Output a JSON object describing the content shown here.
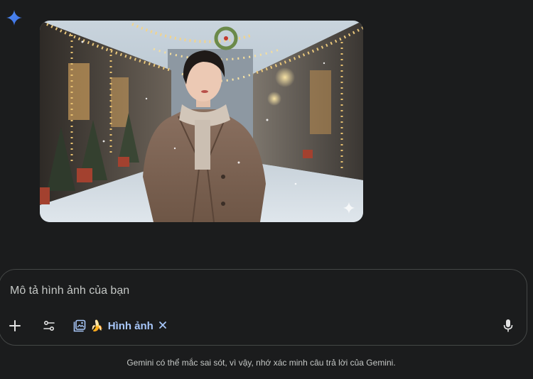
{
  "logo": {
    "icon": "gemini-spark-icon",
    "color": "#4285f4"
  },
  "generated_image": {
    "subject": "Woman in a brown coat and beige scarf on a snowy alley with Christmas lights",
    "watermark_icon": "sparkle-icon"
  },
  "composer": {
    "placeholder": "Mô tả hình ảnh của bạn",
    "add_icon": "plus-icon",
    "tools_icon": "tune-icon",
    "mode_chip": {
      "icon": "image-gallery-icon",
      "emoji": "🍌",
      "label": "Hình ảnh",
      "close_icon": "close-icon"
    },
    "mic_icon": "mic-icon"
  },
  "footer": {
    "disclaimer": "Gemini có thể mắc sai sót, vì vậy, nhớ xác minh câu trả lời của Gemini."
  },
  "colors": {
    "background": "#1b1c1d",
    "accent": "#a8c7fa",
    "border": "#444746",
    "text": "#e3e3e3"
  }
}
